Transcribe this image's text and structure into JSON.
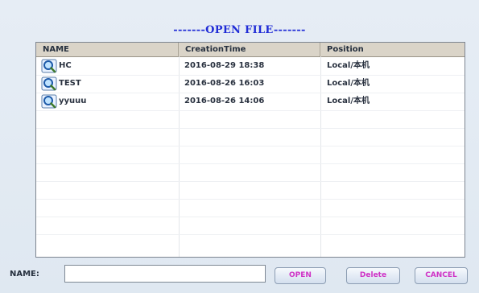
{
  "dialog": {
    "title": "-------OPEN FILE-------"
  },
  "table": {
    "headers": [
      "NAME",
      "CreationTime",
      "Position"
    ],
    "rows": [
      {
        "name": "HC",
        "time": "2016-08-29 18:38",
        "position": "Local/本机",
        "icon": "search-file-icon"
      },
      {
        "name": "TEST",
        "time": "2016-08-26 16:03",
        "position": "Local/本机",
        "icon": "search-file-icon"
      },
      {
        "name": "yyuuu",
        "time": "2016-08-26 14:06",
        "position": "Local/本机",
        "icon": "search-file-icon"
      }
    ]
  },
  "footer": {
    "name_label": "NAME:",
    "name_value": "",
    "open_label": "OPEN",
    "delete_label": "Delete",
    "cancel_label": "CANCEL"
  },
  "colors": {
    "title": "#1f2bd6",
    "button_text": "#cf33c6",
    "header_bg": "#dad4c8"
  }
}
